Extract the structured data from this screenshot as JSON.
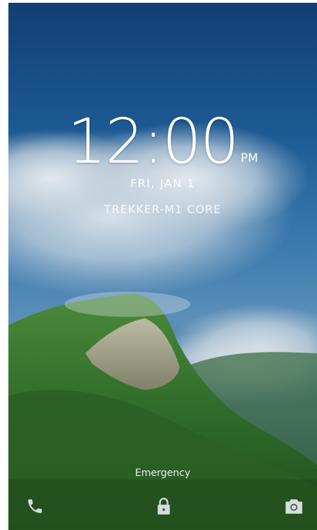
{
  "lockscreen": {
    "time": "12:00",
    "ampm": "PM",
    "date": "FRI, JAN 1",
    "owner_info": "TREKKER-M1 CORE",
    "emergency_label": "Emergency"
  },
  "icons": {
    "phone": "phone-icon",
    "lock": "lock-icon",
    "camera": "camera-icon"
  },
  "colors": {
    "sky_top": "#123f73",
    "forest": "#2f6b2a",
    "text": "#ffffff"
  }
}
